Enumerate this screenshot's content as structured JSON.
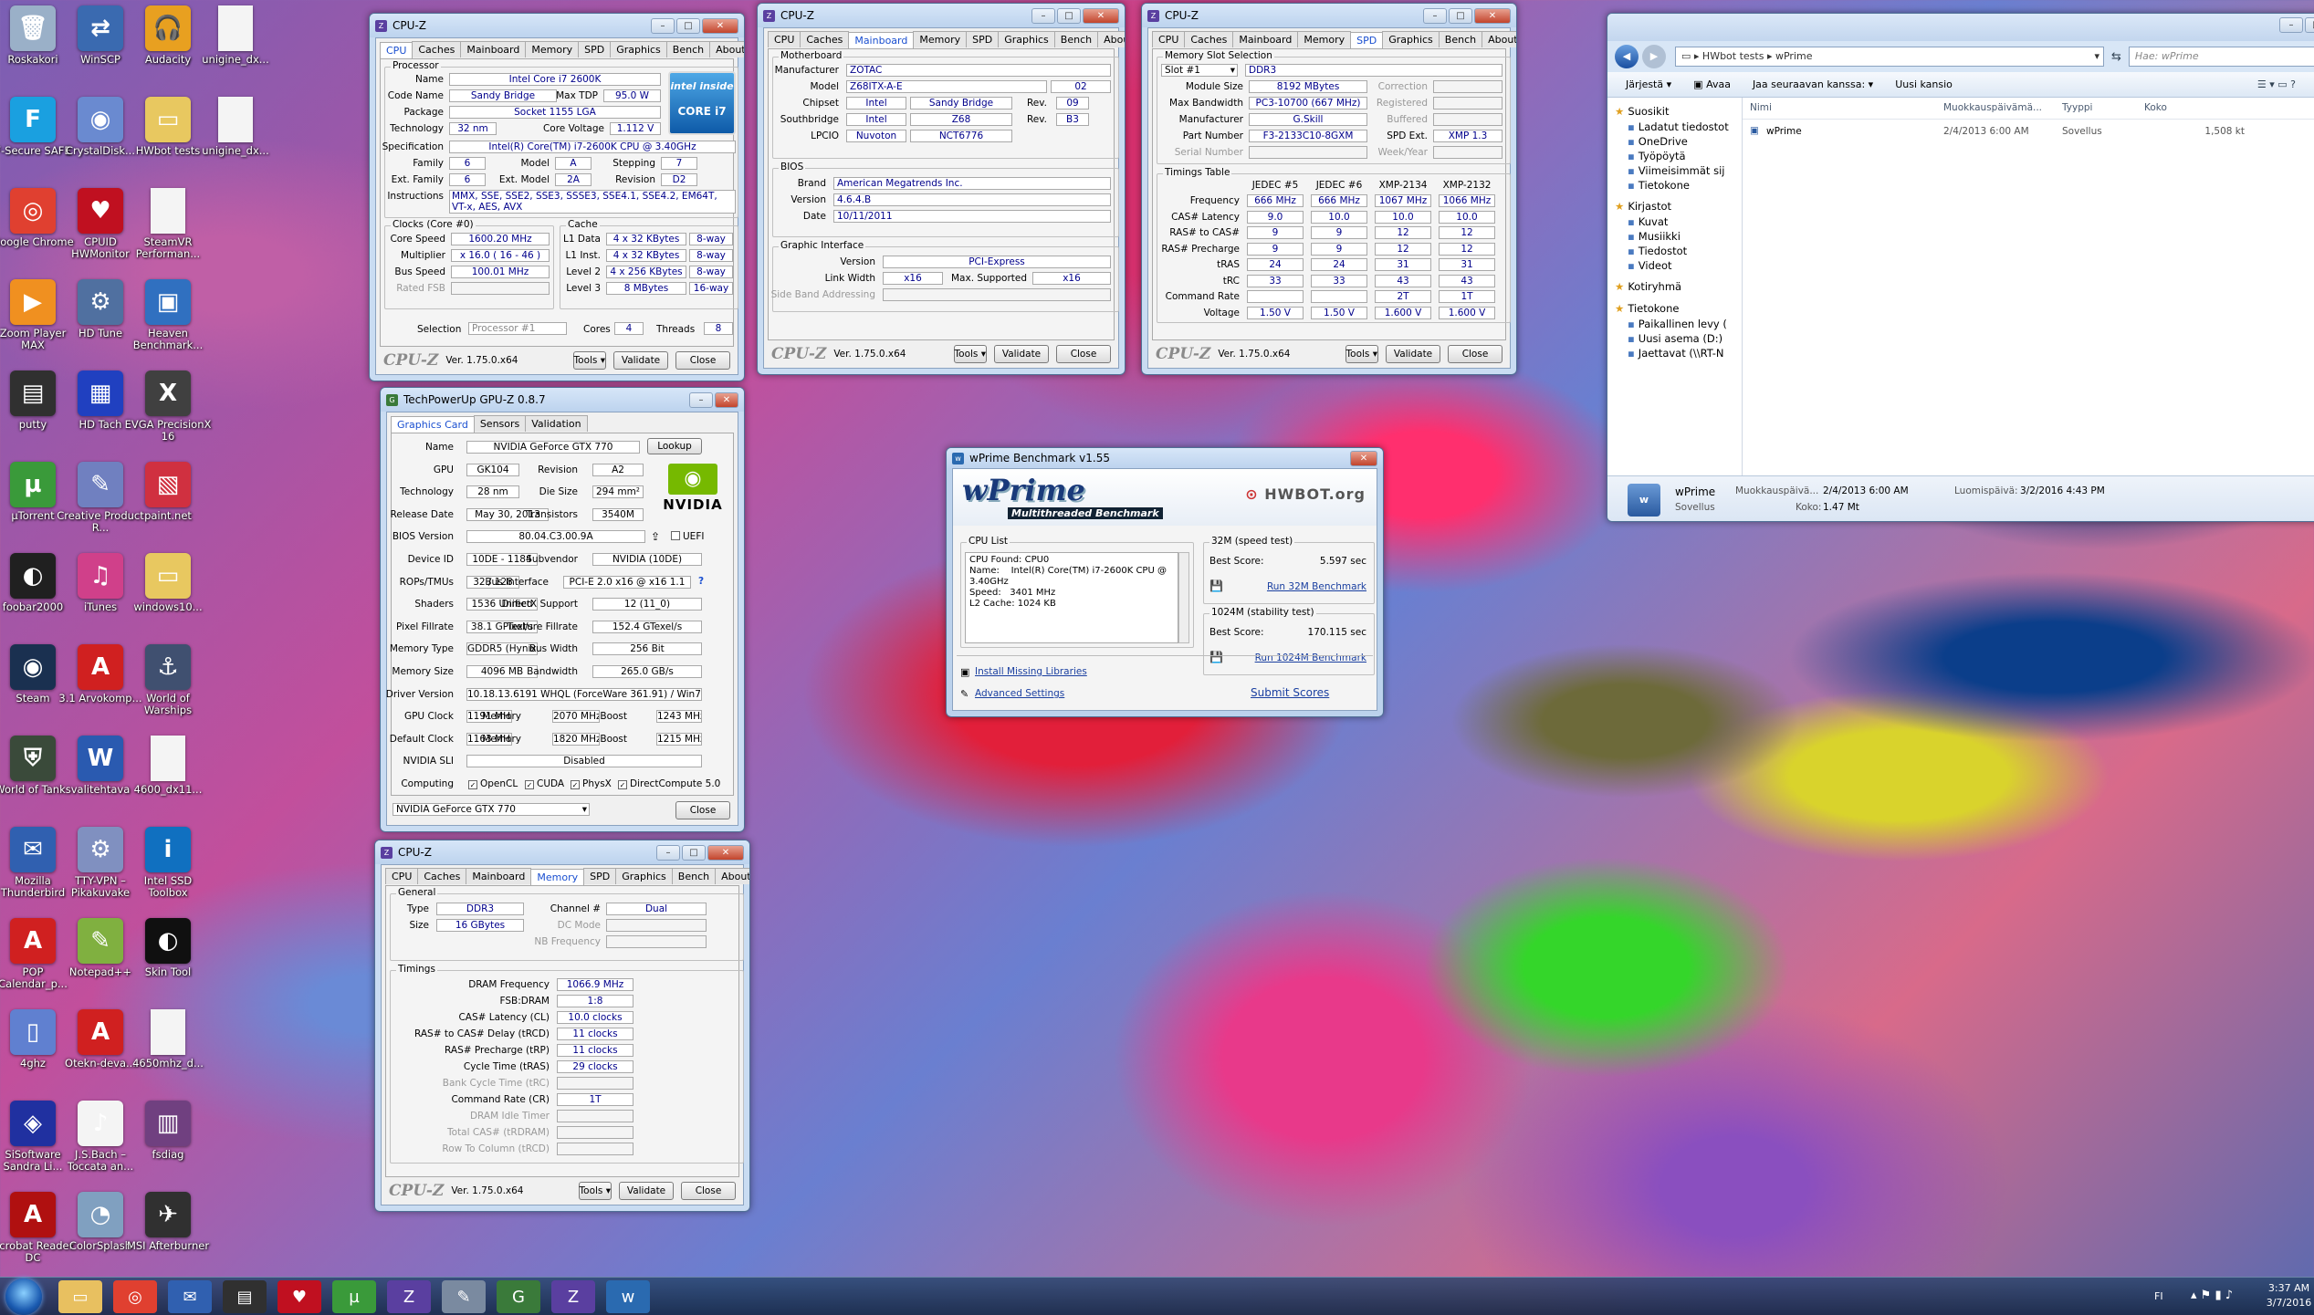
{
  "desktop_icons": [
    {
      "label": "Roskakori",
      "x": 0,
      "y": 0,
      "c": "#9ab0c8",
      "g": "🗑"
    },
    {
      "label": "WinSCP",
      "x": 1,
      "y": 0,
      "c": "#3a6ab0",
      "g": "⇄"
    },
    {
      "label": "Audacity",
      "x": 2,
      "y": 0,
      "c": "#e8a020",
      "g": "🎧"
    },
    {
      "label": "unigine_dx...",
      "x": 3,
      "y": 0,
      "c": "#f4f4f4",
      "g": ""
    },
    {
      "label": "F-Secure SAFE",
      "x": 0,
      "y": 1,
      "c": "#1aa0e0",
      "g": "F"
    },
    {
      "label": "CrystalDisk...",
      "x": 1,
      "y": 1,
      "c": "#6a8ad0",
      "g": "◉"
    },
    {
      "label": "HWbot tests",
      "x": 2,
      "y": 1,
      "c": "#e8c860",
      "g": "▭"
    },
    {
      "label": "unigine_dx...",
      "x": 3,
      "y": 1,
      "c": "#f4f4f4",
      "g": ""
    },
    {
      "label": "Google Chrome",
      "x": 0,
      "y": 2,
      "c": "#e04030",
      "g": "◎"
    },
    {
      "label": "CPUID HWMonitor",
      "x": 1,
      "y": 2,
      "c": "#c01020",
      "g": "♥"
    },
    {
      "label": "SteamVR Performan...",
      "x": 2,
      "y": 2,
      "c": "#f4f4f4",
      "g": ""
    },
    {
      "label": "Zoom Player MAX",
      "x": 0,
      "y": 3,
      "c": "#f09020",
      "g": "▶"
    },
    {
      "label": "HD Tune",
      "x": 1,
      "y": 3,
      "c": "#5070a0",
      "g": "⚙"
    },
    {
      "label": "Heaven Benchmark...",
      "x": 2,
      "y": 3,
      "c": "#3070c0",
      "g": "▣"
    },
    {
      "label": "putty",
      "x": 0,
      "y": 4,
      "c": "#303030",
      "g": "▤"
    },
    {
      "label": "HD Tach",
      "x": 1,
      "y": 4,
      "c": "#2040c0",
      "g": "▦"
    },
    {
      "label": "EVGA PrecisionX 16",
      "x": 2,
      "y": 4,
      "c": "#404040",
      "g": "X"
    },
    {
      "label": "µTorrent",
      "x": 0,
      "y": 5,
      "c": "#3a9a3a",
      "g": "µ"
    },
    {
      "label": "Creative Product R...",
      "x": 1,
      "y": 5,
      "c": "#7080c0",
      "g": "✎"
    },
    {
      "label": "paint.net",
      "x": 2,
      "y": 5,
      "c": "#d03040",
      "g": "▧"
    },
    {
      "label": "foobar2000",
      "x": 0,
      "y": 6,
      "c": "#202020",
      "g": "◐"
    },
    {
      "label": "iTunes",
      "x": 1,
      "y": 6,
      "c": "#d0408a",
      "g": "♫"
    },
    {
      "label": "windows10...",
      "x": 2,
      "y": 6,
      "c": "#e8c860",
      "g": "▭"
    },
    {
      "label": "Steam",
      "x": 0,
      "y": 7,
      "c": "#1a3050",
      "g": "◉"
    },
    {
      "label": "3.1 Arvokomp...",
      "x": 1,
      "y": 7,
      "c": "#d02020",
      "g": "A"
    },
    {
      "label": "World of Warships",
      "x": 2,
      "y": 7,
      "c": "#405070",
      "g": "⚓"
    },
    {
      "label": "World of Tanks",
      "x": 0,
      "y": 8,
      "c": "#3a4a3a",
      "g": "⛨"
    },
    {
      "label": "valitehtava",
      "x": 1,
      "y": 8,
      "c": "#2a5ab0",
      "g": "W"
    },
    {
      "label": "4600_dx11...",
      "x": 2,
      "y": 8,
      "c": "#f4f4f4",
      "g": ""
    },
    {
      "label": "Mozilla Thunderbird",
      "x": 0,
      "y": 9,
      "c": "#3060b0",
      "g": "✉"
    },
    {
      "label": "TTY-VPN – Pikakuvake",
      "x": 1,
      "y": 9,
      "c": "#8090c0",
      "g": "⚙"
    },
    {
      "label": "Intel SSD Toolbox",
      "x": 2,
      "y": 9,
      "c": "#1070c0",
      "g": "i"
    },
    {
      "label": "POP Calendar_p...",
      "x": 0,
      "y": 10,
      "c": "#d02020",
      "g": "A"
    },
    {
      "label": "Notepad++",
      "x": 1,
      "y": 10,
      "c": "#80b040",
      "g": "✎"
    },
    {
      "label": "Skin Tool",
      "x": 2,
      "y": 10,
      "c": "#101010",
      "g": "◐"
    },
    {
      "label": "4ghz",
      "x": 0,
      "y": 11,
      "c": "#6080d0",
      "g": "▯"
    },
    {
      "label": "Otekn-deva...",
      "x": 1,
      "y": 11,
      "c": "#d02020",
      "g": "A"
    },
    {
      "label": "4650mhz_d...",
      "x": 2,
      "y": 11,
      "c": "#f4f4f4",
      "g": ""
    },
    {
      "label": "SiSoftware Sandra Li...",
      "x": 0,
      "y": 12,
      "c": "#2030a0",
      "g": "◈"
    },
    {
      "label": "J.S.Bach – Toccata an...",
      "x": 1,
      "y": 12,
      "c": "#f4f4f4",
      "g": "♪"
    },
    {
      "label": "fsdiag",
      "x": 2,
      "y": 12,
      "c": "#704080",
      "g": "▥"
    },
    {
      "label": "Acrobat Reader DC",
      "x": 0,
      "y": 13,
      "c": "#b01010",
      "g": "A"
    },
    {
      "label": "ColorSplash",
      "x": 1,
      "y": 13,
      "c": "#80a0c0",
      "g": "◔"
    },
    {
      "label": "MSI Afterburner",
      "x": 2,
      "y": 13,
      "c": "#303030",
      "g": "✈"
    }
  ],
  "cpuz_cpu": {
    "title": "CPU-Z",
    "tabs": [
      "CPU",
      "Caches",
      "Mainboard",
      "Memory",
      "SPD",
      "Graphics",
      "Bench",
      "About"
    ],
    "processor_label": "Processor",
    "name_l": "Name",
    "name": "Intel Core i7 2600K",
    "codename_l": "Code Name",
    "codename": "Sandy Bridge",
    "maxtdp_l": "Max TDP",
    "maxtdp": "95.0 W",
    "package_l": "Package",
    "package": "Socket 1155 LGA",
    "tech_l": "Technology",
    "tech": "32 nm",
    "cv_l": "Core Voltage",
    "cv": "1.112 V",
    "spec_l": "Specification",
    "spec": "Intel(R) Core(TM) i7-2600K CPU @ 3.40GHz",
    "family_l": "Family",
    "family": "6",
    "model_l": "Model",
    "model": "A",
    "stepping_l": "Stepping",
    "stepping": "7",
    "extfam_l": "Ext. Family",
    "extfam": "6",
    "extmodel_l": "Ext. Model",
    "extmodel": "2A",
    "rev_l": "Revision",
    "rev": "D2",
    "instr_l": "Instructions",
    "instr": "MMX, SSE, SSE2, SSE3, SSSE3, SSE4.1, SSE4.2, EM64T, VT-x, AES, AVX",
    "clocks_label": "Clocks (Core #0)",
    "cs_l": "Core Speed",
    "cs": "1600.20 MHz",
    "mult_l": "Multiplier",
    "mult": "x 16.0 ( 16 - 46 )",
    "bus_l": "Bus Speed",
    "bus": "100.01 MHz",
    "fsb_l": "Rated FSB",
    "cache_label": "Cache",
    "l1d_l": "L1 Data",
    "l1d": "4 x 32 KBytes",
    "l1d_w": "8-way",
    "l1i_l": "L1 Inst.",
    "l1i": "4 x 32 KBytes",
    "l1i_w": "8-way",
    "l2_l": "Level 2",
    "l2": "4 x 256 KBytes",
    "l2_w": "8-way",
    "l3_l": "Level 3",
    "l3": "8 MBytes",
    "l3_w": "16-way",
    "sel_l": "Selection",
    "sel": "Processor #1",
    "cores_l": "Cores",
    "cores": "4",
    "threads_l": "Threads",
    "threads": "8",
    "intel_inside": "intel inside",
    "intel_core": "CORE i7"
  },
  "cpuz_common": {
    "brand": "CPU-Z",
    "ver": "Ver. 1.75.0.x64",
    "tools": "Tools",
    "validate": "Validate",
    "close": "Close"
  },
  "cpuz_mb": {
    "title": "CPU-Z",
    "tabs": [
      "CPU",
      "Caches",
      "Mainboard",
      "Memory",
      "SPD",
      "Graphics",
      "Bench",
      "About"
    ],
    "mb_label": "Motherboard",
    "manu_l": "Manufacturer",
    "manu": "ZOTAC",
    "model_l": "Model",
    "model": "Z68ITX-A-E",
    "model_rev": "02",
    "chipset_l": "Chipset",
    "chipset_a": "Intel",
    "chipset_b": "Sandy Bridge",
    "chipset_rev_l": "Rev.",
    "chipset_rev": "09",
    "sb_l": "Southbridge",
    "sb_a": "Intel",
    "sb_b": "Z68",
    "sb_rev_l": "Rev.",
    "sb_rev": "B3",
    "lpcio_l": "LPCIO",
    "lpcio_a": "Nuvoton",
    "lpcio_b": "NCT6776",
    "bios_label": "BIOS",
    "brand_l": "Brand",
    "brand": "American Megatrends Inc.",
    "version_l": "Version",
    "version": "4.6.4.B",
    "date_l": "Date",
    "date": "10/11/2011",
    "gi_label": "Graphic Interface",
    "gi_ver_l": "Version",
    "gi_ver": "PCI-Express",
    "lw_l": "Link Width",
    "lw": "x16",
    "ms_l": "Max. Supported",
    "ms": "x16",
    "sba_l": "Side Band Addressing"
  },
  "cpuz_spd": {
    "title": "CPU-Z",
    "tabs": [
      "CPU",
      "Caches",
      "Mainboard",
      "Memory",
      "SPD",
      "Graphics",
      "Bench",
      "About"
    ],
    "slot_label": "Memory Slot Selection",
    "slot": "Slot #1",
    "type": "DDR3",
    "ms_l": "Module Size",
    "ms": "8192 MBytes",
    "corr_l": "Correction",
    "mb_l": "Max Bandwidth",
    "mb": "PC3-10700 (667 MHz)",
    "reg_l": "Registered",
    "manu_l": "Manufacturer",
    "manu": "G.Skill",
    "buf_l": "Buffered",
    "pn_l": "Part Number",
    "pn": "F3-2133C10-8GXM",
    "spdext_l": "SPD Ext.",
    "spdext": "XMP 1.3",
    "sn_l": "Serial Number",
    "wy_l": "Week/Year",
    "timings_label": "Timings Table",
    "cols": [
      "JEDEC #5",
      "JEDEC #6",
      "XMP-2134",
      "XMP-2132"
    ],
    "rows": [
      {
        "l": "Frequency",
        "v": [
          "666 MHz",
          "666 MHz",
          "1067 MHz",
          "1066 MHz"
        ]
      },
      {
        "l": "CAS# Latency",
        "v": [
          "9.0",
          "10.0",
          "10.0",
          "10.0"
        ]
      },
      {
        "l": "RAS# to CAS#",
        "v": [
          "9",
          "9",
          "12",
          "12"
        ]
      },
      {
        "l": "RAS# Precharge",
        "v": [
          "9",
          "9",
          "12",
          "12"
        ]
      },
      {
        "l": "tRAS",
        "v": [
          "24",
          "24",
          "31",
          "31"
        ]
      },
      {
        "l": "tRC",
        "v": [
          "33",
          "33",
          "43",
          "43"
        ]
      },
      {
        "l": "Command Rate",
        "v": [
          "",
          "",
          "2T",
          "1T"
        ]
      },
      {
        "l": "Voltage",
        "v": [
          "1.50 V",
          "1.50 V",
          "1.600 V",
          "1.600 V"
        ]
      }
    ]
  },
  "gpuz": {
    "title": "TechPowerUp GPU-Z 0.8.7",
    "tabs": [
      "Graphics Card",
      "Sensors",
      "Validation"
    ],
    "name_l": "Name",
    "name": "NVIDIA GeForce GTX 770",
    "lookup": "Lookup",
    "gpu_l": "GPU",
    "gpu": "GK104",
    "rev_l": "Revision",
    "rev": "A2",
    "tech_l": "Technology",
    "tech": "28 nm",
    "die_l": "Die Size",
    "die": "294 mm²",
    "rd_l": "Release Date",
    "rd": "May 30, 2013",
    "tr_l": "Transistors",
    "tr": "3540M",
    "bios_l": "BIOS Version",
    "bios": "80.04.C3.00.9A",
    "uefi": "UEFI",
    "did_l": "Device ID",
    "did": "10DE - 1184",
    "sub_l": "Subvendor",
    "sub": "NVIDIA (10DE)",
    "rops_l": "ROPs/TMUs",
    "rops": "32 / 128",
    "bi_l": "Bus Interface",
    "bi": "PCI-E 2.0 x16 @ x16 1.1",
    "sh_l": "Shaders",
    "sh": "1536 Unified",
    "dx_l": "DirectX Support",
    "dx": "12 (11_0)",
    "pf_l": "Pixel Fillrate",
    "pf": "38.1 GPixel/s",
    "tf_l": "Texture Fillrate",
    "tf": "152.4 GTexel/s",
    "mt_l": "Memory Type",
    "mt": "GDDR5 (Hynix)",
    "bw_l": "Bus Width",
    "bw": "256 Bit",
    "msz_l": "Memory Size",
    "msz": "4096 MB",
    "band_l": "Bandwidth",
    "band": "265.0 GB/s",
    "drv_l": "Driver Version",
    "drv": "10.18.13.6191 WHQL (ForceWare 361.91) / Win7 64",
    "gc_l": "GPU Clock",
    "gc": "1191 MHz",
    "mem_l": "Memory",
    "gmem": "2070 MHz",
    "boost_l": "Boost",
    "gboost": "1243 MHz",
    "dc_l": "Default Clock",
    "dc": "1163 MHz",
    "dmem": "1820 MHz",
    "dboost": "1215 MHz",
    "sli_l": "NVIDIA SLI",
    "sli": "Disabled",
    "comp_l": "Computing",
    "opencl": "OpenCL",
    "cuda": "CUDA",
    "physx": "PhysX",
    "dc5": "DirectCompute 5.0",
    "select": "NVIDIA GeForce GTX 770",
    "close": "Close",
    "nvidia": "NVIDIA"
  },
  "cpuz_mem": {
    "title": "CPU-Z",
    "tabs": [
      "CPU",
      "Caches",
      "Mainboard",
      "Memory",
      "SPD",
      "Graphics",
      "Bench",
      "About"
    ],
    "gen_label": "General",
    "type_l": "Type",
    "type": "DDR3",
    "ch_l": "Channel #",
    "ch": "Dual",
    "size_l": "Size",
    "size": "16 GBytes",
    "dcm_l": "DC Mode",
    "nb_l": "NB Frequency",
    "tim_label": "Timings",
    "rows": [
      {
        "l": "DRAM Frequency",
        "v": "1066.9 MHz",
        "d": false
      },
      {
        "l": "FSB:DRAM",
        "v": "1:8",
        "d": false
      },
      {
        "l": "CAS# Latency (CL)",
        "v": "10.0 clocks",
        "d": false
      },
      {
        "l": "RAS# to CAS# Delay (tRCD)",
        "v": "11 clocks",
        "d": false
      },
      {
        "l": "RAS# Precharge (tRP)",
        "v": "11 clocks",
        "d": false
      },
      {
        "l": "Cycle Time (tRAS)",
        "v": "29 clocks",
        "d": false
      },
      {
        "l": "Bank Cycle Time (tRC)",
        "v": "",
        "d": true
      },
      {
        "l": "Command Rate (CR)",
        "v": "1T",
        "d": false
      },
      {
        "l": "DRAM Idle Timer",
        "v": "",
        "d": true
      },
      {
        "l": "Total CAS# (tRDRAM)",
        "v": "",
        "d": true
      },
      {
        "l": "Row To Column (tRCD)",
        "v": "",
        "d": true
      }
    ]
  },
  "wprime": {
    "title": "wPrime Benchmark v1.55",
    "logo": "wPrime",
    "sub": "Multithreaded Benchmark",
    "hwbot": "HWBOT.org",
    "cpulist_l": "CPU List",
    "cpu_lines": [
      "CPU Found: CPU0",
      "Name:    Intel(R) Core(TM) i7-2600K CPU @",
      "3.40GHz",
      "Speed:   3401 MHz",
      "L2 Cache: 1024 KB"
    ],
    "t32_l": "32M (speed test)",
    "best_l": "Best Score:",
    "t32": "5.597 sec",
    "run32": "Run 32M Benchmark",
    "t1024_l": "1024M (stability test)",
    "t1024": "170.115 sec",
    "run1024": "Run 1024M Benchmark",
    "install": "Install Missing Libraries",
    "adv": "Advanced Settings",
    "submit": "Submit Scores"
  },
  "explorer": {
    "crumb": [
      "HWbot tests",
      "wPrime"
    ],
    "search_ph": "Hae: wPrime",
    "toolbar": [
      "Järjestä",
      "Avaa",
      "Jaa seuraavan kanssa:",
      "Uusi kansio"
    ],
    "nav": [
      {
        "l": "Suosikit",
        "h": true
      },
      {
        "l": "Ladatut tiedostot"
      },
      {
        "l": "OneDrive"
      },
      {
        "l": "Työpöytä"
      },
      {
        "l": "Viimeisimmät sij"
      },
      {
        "l": "Tietokone"
      },
      {
        "l": "Kirjastot",
        "h": true
      },
      {
        "l": "Kuvat"
      },
      {
        "l": "Musiikki"
      },
      {
        "l": "Tiedostot"
      },
      {
        "l": "Videot"
      },
      {
        "l": "Kotiryhmä",
        "h": true
      },
      {
        "l": "Tietokone",
        "h": true
      },
      {
        "l": "Paikallinen levy ("
      },
      {
        "l": "Uusi asema (D:)"
      },
      {
        "l": "Jaettavat (\\\\RT-N"
      }
    ],
    "cols": [
      "Nimi",
      "Muokkauspäivämä...",
      "Tyyppi",
      "Koko"
    ],
    "files": [
      {
        "name": "wPrime",
        "date": "2/4/2013 6:00 AM",
        "type": "Sovellus",
        "size": "1,508 kt"
      }
    ],
    "det_name": "wPrime",
    "det_type": "Sovellus",
    "det_mod_l": "Muokkauspäivä...",
    "det_mod": "2/4/2013 6:00 AM",
    "det_cr_l": "Luomispäivä:",
    "det_cr": "3/2/2016 4:43 PM",
    "det_size_l": "Koko:",
    "det_size": "1.47 Mt"
  },
  "taskbar": {
    "lang": "FI",
    "time": "3:37 AM",
    "date": "3/7/2016"
  }
}
